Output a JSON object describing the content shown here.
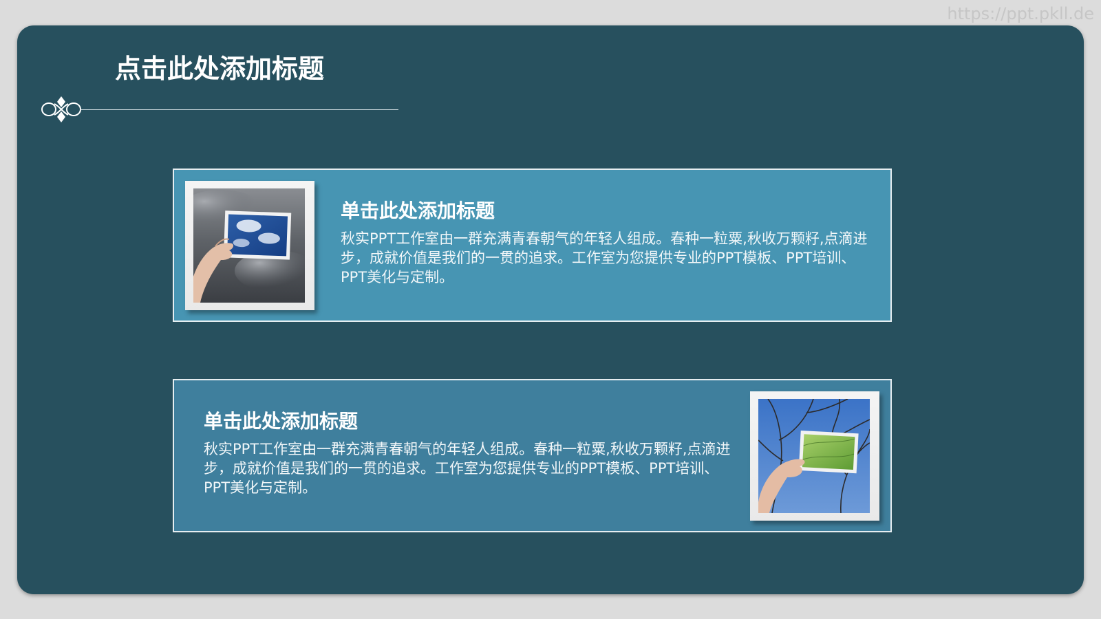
{
  "watermark": "https://ppt.pkll.de",
  "slide": {
    "title": "点击此处添加标题"
  },
  "cards": [
    {
      "heading": "单击此处添加标题",
      "body": "秋实PPT工作室由一群充满青春朝气的年轻人组成。春种一粒粟,秋收万颗籽,点滴进步，成就价值是我们的一贯的追求。工作室为您提供专业的PPT模板、PPT培训、PPT美化与定制。",
      "image": "hand-holding-sky-photo"
    },
    {
      "heading": "单击此处添加标题",
      "body": "秋实PPT工作室由一群充满青春朝气的年轻人组成。春种一粒粟,秋收万颗籽,点滴进步，成就价值是我们的一贯的追求。工作室为您提供专业的PPT模板、PPT培训、PPT美化与定制。",
      "image": "hand-holding-leaves-photo"
    }
  ],
  "colors": {
    "slide_bg": "#27505e",
    "card_1_bg": "#4795b3",
    "card_2_bg": "#3f7f9d",
    "outer_bg": "#dcdcdc"
  }
}
